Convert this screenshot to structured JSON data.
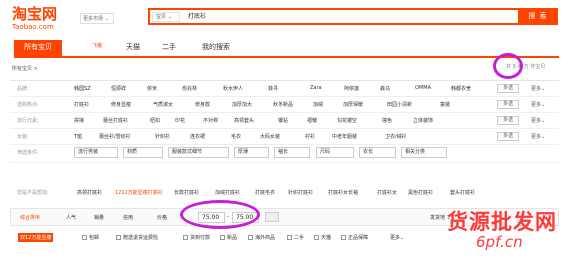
{
  "logo": {
    "cn": "淘宝网",
    "en": "Taobao.com"
  },
  "market": {
    "label": "更多市场 ⌄"
  },
  "search": {
    "category": "宝贝 ⌄",
    "query": "打底衫",
    "button": "搜 索"
  },
  "tabs": [
    "所有宝贝",
    "天猫",
    "二手",
    "我的搜索"
  ],
  "tab_logo": "飞猪",
  "breadcrumb": "所有宝贝 >",
  "result_count": "共 9.47万 件宝贝",
  "rows": [
    {
      "label": "品牌:",
      "options": [
        "韩国SZ",
        "恒源祥",
        "依米",
        "俞兆林",
        "秋水伊人",
        "菲寻",
        "Zara",
        "阿依莲",
        "森马",
        "OMMA",
        "韩都衣舍"
      ]
    },
    {
      "label": "选购热点:",
      "options": [
        "打底衫",
        "修身显瘦",
        "气质淑女",
        "修身款",
        "加厚加大",
        "秋冬新品",
        "加绒",
        "加厚保暖",
        "田园小清新",
        "童装"
      ]
    },
    {
      "label": "流行元素:",
      "options": [
        "拼接",
        "蕾丝打底衫",
        "纽扣",
        "印花",
        "不对称",
        "高领套头",
        "镶钻",
        "褶皱",
        "勾花镂空",
        "撞色",
        "立体装饰"
      ]
    },
    {
      "label": "女装:",
      "options": [
        "T恤",
        "蕾丝衫/雪纺衫",
        "针织衫",
        "连衣裙",
        "毛衣",
        "大码女装",
        "衬衫",
        "中老年服装",
        "卫衣/绒衫"
      ]
    }
  ],
  "multi_label": "多选",
  "more_label": "更多⌄",
  "filter_row": {
    "label": "筛选条件:",
    "dropdowns": [
      "流行男装",
      "材质",
      "服装款式细节",
      "厚薄",
      "袖长",
      "尺码",
      "衣长",
      "相关分类"
    ]
  },
  "related": {
    "label": "您是不是想找:",
    "items": [
      "高领打底衫",
      "1212万能显瘦打底衫",
      "长款打底衫",
      "加绒打底衫",
      "打底毛衣",
      "针织打底衫",
      "打底衫女长袖",
      "打底衫女",
      "黑色打底衫",
      "套头打底衫"
    ]
  },
  "sort": {
    "items": [
      "综合排序",
      "人气",
      "销量",
      "信用",
      "价格"
    ],
    "price_from": "75.00",
    "price_to": "75.00",
    "ship_from": "发货地 ⌄"
  },
  "filters": {
    "items": [
      "包邮",
      "赠送退货运费险",
      "货到付款",
      "新品",
      "海外商品",
      "二手",
      "天猫",
      "正品保障"
    ],
    "more": "更多⌄"
  },
  "promo_tag": "双12万能显瘦",
  "watermark": {
    "line1": "货源批发网",
    "line2": "6pf.cn"
  },
  "colors": {
    "accent": "#ff4400",
    "circle": "#c51fd6",
    "watermark": "#ff3a3a"
  }
}
